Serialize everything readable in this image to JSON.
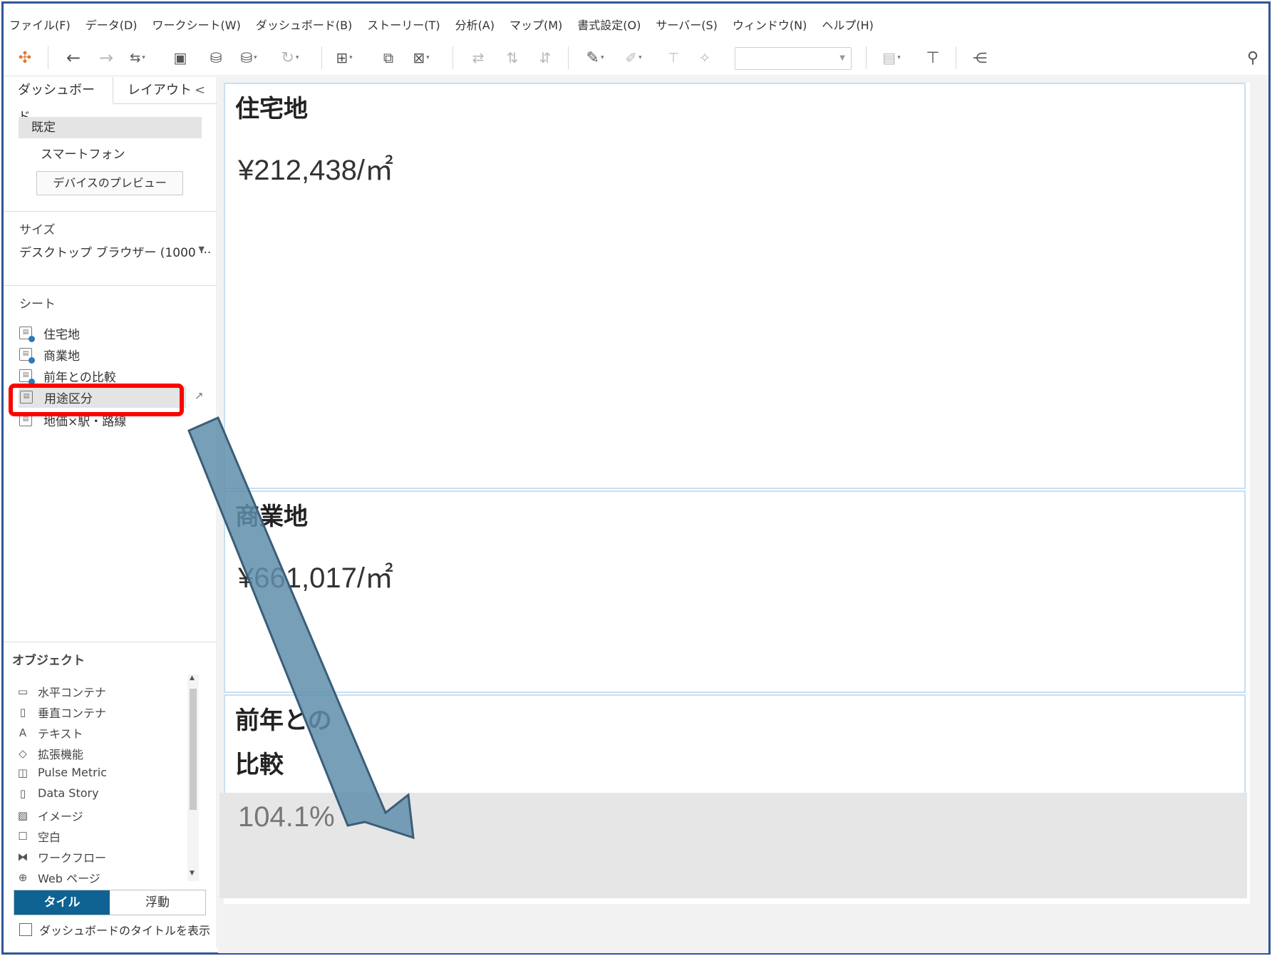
{
  "menu": [
    "ファイル(F)",
    "データ(D)",
    "ワークシート(W)",
    "ダッシュボード(B)",
    "ストーリー(T)",
    "分析(A)",
    "マップ(M)",
    "書式設定(O)",
    "サーバー(S)",
    "ウィンドウ(N)",
    "ヘルプ(H)"
  ],
  "left_panel": {
    "tabs": {
      "dashboard": "ダッシュボード",
      "layout": "レイアウト",
      "collapse": "<"
    },
    "device": {
      "default": "既定",
      "phone": "スマートフォン",
      "preview_button": "デバイスのプレビュー"
    },
    "size": {
      "label": "サイズ",
      "value": "デスクトップ ブラウザー (1000 ···"
    },
    "sheets": {
      "label": "シート",
      "items": [
        {
          "label": "住宅地"
        },
        {
          "label": "商業地"
        },
        {
          "label": "前年との比較"
        },
        {
          "label": "用途区分"
        },
        {
          "label": "地価×駅・路線"
        }
      ]
    },
    "objects": {
      "label": "オブジェクト",
      "items": [
        {
          "icon": "horizontal-container-icon",
          "label": "水平コンテナ"
        },
        {
          "icon": "vertical-container-icon",
          "label": "垂直コンテナ"
        },
        {
          "icon": "text-icon",
          "label": "テキスト"
        },
        {
          "icon": "extension-icon",
          "label": "拡張機能"
        },
        {
          "icon": "pulse-metric-icon",
          "label": "Pulse Metric"
        },
        {
          "icon": "data-story-icon",
          "label": "Data Story"
        },
        {
          "icon": "image-icon",
          "label": "イメージ"
        },
        {
          "icon": "blank-icon",
          "label": "空白"
        },
        {
          "icon": "workflow-icon",
          "label": "ワークフロー"
        },
        {
          "icon": "web-page-icon",
          "label": "Web ページ"
        }
      ]
    },
    "layout_toggle": {
      "tiled": "タイル",
      "floating": "浮動"
    },
    "show_title": "ダッシュボードのタイトルを表示"
  },
  "dashboard": {
    "residential": {
      "title": "住宅地",
      "value": "¥212,438/㎡"
    },
    "commercial": {
      "title": "商業地",
      "value": "¥661,017/㎡"
    },
    "comparison": {
      "title_line1": "前年との",
      "title_line2": "比較",
      "value": "104.1%"
    }
  },
  "colors": {
    "accent": "#0f6393",
    "highlight": "#ff0000",
    "frame": "#2f5597",
    "arrow_fill": "#5f8fab",
    "arrow_stroke": "#3b5e78"
  }
}
